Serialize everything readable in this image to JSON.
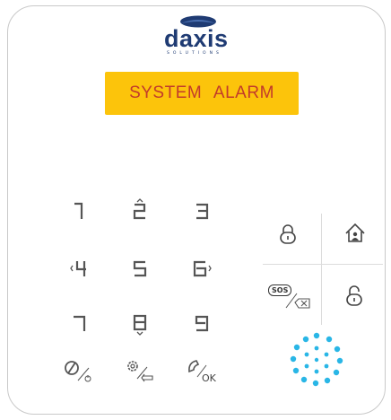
{
  "brand": {
    "name": "daxis",
    "subtitle": "SOLUTIONS",
    "color": "#1f3b73"
  },
  "display": {
    "text": "SYSTEM   ALARM",
    "background": "#fcc40b",
    "text_color": "#c23b2b"
  },
  "keypad": {
    "keys": [
      "1",
      "2",
      "3",
      "4",
      "5",
      "6",
      "7",
      "8",
      "9"
    ],
    "function_keys": [
      {
        "name": "power-key",
        "icon": "power-icon"
      },
      {
        "name": "settings-back-key",
        "icon": "gear-icon"
      },
      {
        "name": "call-ok-key",
        "icon": "phone-icon",
        "label": "OK"
      }
    ]
  },
  "quick_buttons": [
    {
      "name": "arm-away-button",
      "icon": "lock-icon"
    },
    {
      "name": "arm-home-button",
      "icon": "home-icon"
    },
    {
      "name": "sos-delete-button",
      "icon": "sos-icon",
      "label": "SOS"
    },
    {
      "name": "disarm-button",
      "icon": "unlock-icon"
    }
  ],
  "microphone": {
    "icon": "microphone-dots-icon",
    "color": "#29b6e6"
  }
}
